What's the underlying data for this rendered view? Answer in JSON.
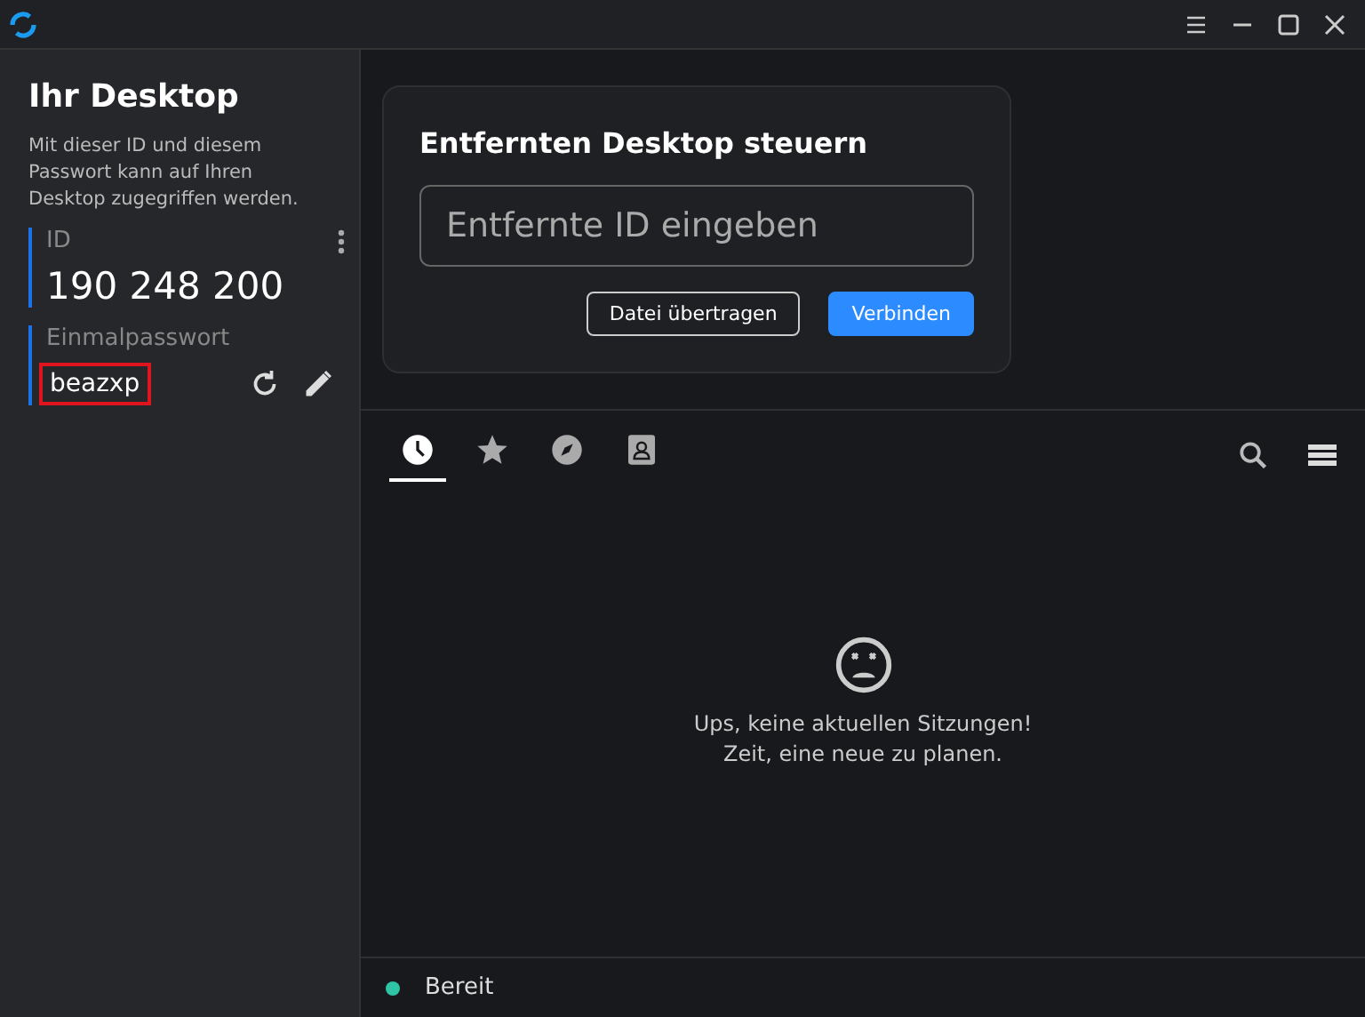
{
  "sidebar": {
    "title": "Ihr Desktop",
    "description": "Mit dieser ID und diesem Passwort kann auf Ihren Desktop zugegriffen werden.",
    "id_label": "ID",
    "id_value": "190 248 200",
    "password_label": "Einmalpasswort",
    "password_value": "beazxp",
    "password_highlighted": true
  },
  "connect_card": {
    "title": "Entfernten Desktop steuern",
    "placeholder": "Entfernte ID eingeben",
    "buttons": [
      {
        "label": "Datei übertragen",
        "kind": "outline"
      },
      {
        "label": "Verbinden",
        "kind": "primary"
      }
    ]
  },
  "tabs": [
    {
      "kind": "clock",
      "selected": true
    },
    {
      "kind": "star",
      "selected": false
    },
    {
      "kind": "compass",
      "selected": false
    },
    {
      "kind": "contact",
      "selected": false
    }
  ],
  "empty_state": {
    "lines": [
      "Ups, keine aktuellen Sitzungen!",
      "Zeit, eine neue zu planen."
    ]
  },
  "status_bar": {
    "text": "Bereit",
    "color": "#2ec4a5"
  }
}
